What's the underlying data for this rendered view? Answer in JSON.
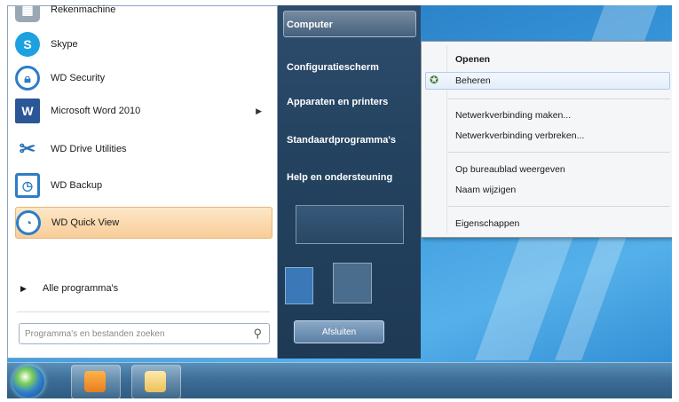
{
  "start_menu": {
    "programs": [
      {
        "label": "Rekenmachine",
        "icon": "calculator-icon"
      },
      {
        "label": "Skype",
        "icon": "skype-icon"
      },
      {
        "label": "WD Security",
        "icon": "wd-security-icon"
      },
      {
        "label": "Microsoft Word 2010",
        "icon": "word-icon"
      },
      {
        "label": "WD Drive Utilities",
        "icon": "tools-icon"
      },
      {
        "label": "WD Backup",
        "icon": "wd-backup-icon"
      },
      {
        "label": "WD Quick View",
        "icon": "wd-quick-view-icon"
      }
    ],
    "all_programs": "Alle programma's",
    "search_placeholder": "Programma's en bestanden zoeken",
    "right_items": [
      "Computer",
      "Configuratiescherm",
      "Apparaten en printers",
      "Standaardprogramma's",
      "Help en ondersteuning"
    ],
    "shutdown_label": "Afsluiten"
  },
  "context_menu": {
    "items": [
      {
        "label": "Openen",
        "bold": true
      },
      {
        "label": "Beheren",
        "icon": "shield-icon",
        "highlighted": true
      },
      {
        "label": "Netwerkverbinding maken..."
      },
      {
        "label": "Netwerkverbinding verbreken..."
      },
      {
        "label": "Op bureaublad weergeven"
      },
      {
        "label": "Naam wijzigen"
      },
      {
        "label": "Eigenschappen"
      }
    ]
  },
  "colors": {
    "highlight_orange": "#f8cd98",
    "menu_blue": "#244360",
    "desktop_blue": "#3591d6"
  }
}
